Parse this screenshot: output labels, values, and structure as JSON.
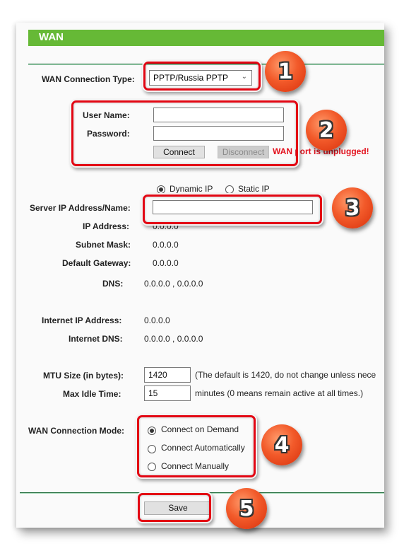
{
  "header": {
    "title": "WAN"
  },
  "connection_type": {
    "label": "WAN Connection Type:",
    "selected": "PPTP/Russia PPTP"
  },
  "credentials": {
    "username_label": "User Name:",
    "username_value": "",
    "password_label": "Password:",
    "password_value": "",
    "connect_label": "Connect",
    "disconnect_label": "Disconnect",
    "warning": "WAN port is unplugged!"
  },
  "ip_mode": {
    "options": [
      {
        "label": "Dynamic IP",
        "checked": true
      },
      {
        "label": "Static IP",
        "checked": false
      }
    ]
  },
  "server": {
    "label": "Server IP Address/Name:",
    "value": ""
  },
  "status": {
    "ip_address_label": "IP Address:",
    "ip_address": "0.0.0.0",
    "subnet_mask_label": "Subnet Mask:",
    "subnet_mask": "0.0.0.0",
    "default_gateway_label": "Default Gateway:",
    "default_gateway": "0.0.0.0",
    "dns_label": "DNS:",
    "dns": "0.0.0.0 , 0.0.0.0",
    "internet_ip_label": "Internet IP Address:",
    "internet_ip": "0.0.0.0",
    "internet_dns_label": "Internet DNS:",
    "internet_dns": "0.0.0.0 , 0.0.0.0"
  },
  "mtu": {
    "label": "MTU Size (in bytes):",
    "value": "1420",
    "hint": "(The default is 1420, do not change unless nece"
  },
  "idle": {
    "label": "Max Idle Time:",
    "value": "15",
    "hint": "minutes (0 means remain active at all times.)"
  },
  "connection_mode": {
    "label": "WAN Connection Mode:",
    "options": [
      {
        "label": "Connect on Demand",
        "checked": true
      },
      {
        "label": "Connect Automatically",
        "checked": false
      },
      {
        "label": "Connect Manually",
        "checked": false
      }
    ]
  },
  "save_label": "Save",
  "badges": [
    "1",
    "2",
    "3",
    "4",
    "5"
  ],
  "colors": {
    "header_green": "#66b936",
    "highlight_red": "#e30613",
    "warning_red": "#e3121e",
    "badge_orange": "#f25a2a"
  }
}
